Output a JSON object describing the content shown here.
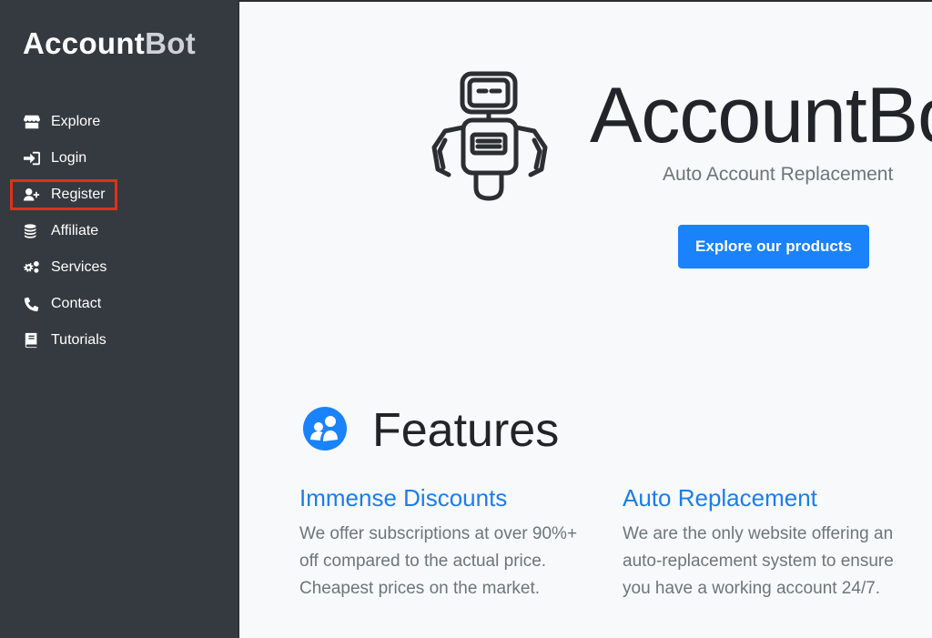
{
  "sidebar": {
    "brand_main": "Account",
    "brand_accent": "Bot",
    "items": [
      {
        "label": "Explore",
        "icon": "store-icon"
      },
      {
        "label": "Login",
        "icon": "sign-in-icon"
      },
      {
        "label": "Register",
        "icon": "user-plus-icon",
        "highlighted": true
      },
      {
        "label": "Affiliate",
        "icon": "coins-icon"
      },
      {
        "label": "Services",
        "icon": "gears-icon"
      },
      {
        "label": "Contact",
        "icon": "phone-icon"
      },
      {
        "label": "Tutorials",
        "icon": "book-icon"
      }
    ],
    "highlight_color": "#e0311a"
  },
  "hero": {
    "title": "AccountBot",
    "subtitle": "Auto Account Replacement",
    "cta_label": "Explore our products"
  },
  "features": {
    "title": "Features",
    "items": [
      {
        "heading": "Immense Discounts",
        "text": "We offer subscriptions at over 90%+ off compared to the actual price. Cheapest prices on the market."
      },
      {
        "heading": "Auto Replacement",
        "text": "We are the only website offering an auto-replacement system to ensure you have a working account 24/7."
      }
    ]
  },
  "colors": {
    "sidebar_bg": "#343a40",
    "accent_blue": "#1a82fb",
    "feature_heading": "#1b7ded",
    "main_bg": "#f8f9fa"
  }
}
